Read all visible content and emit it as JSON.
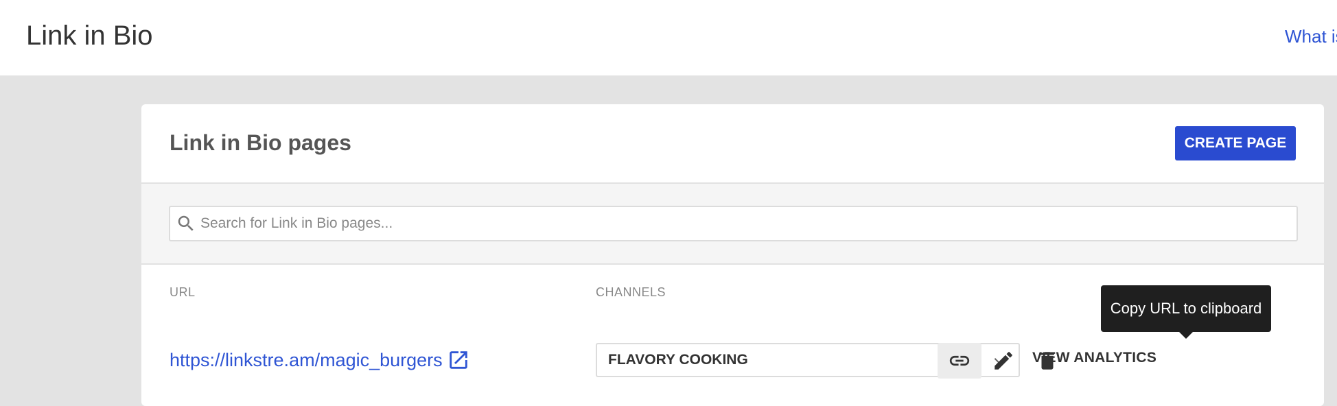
{
  "header": {
    "title": "Link in Bio",
    "help_link": "What is"
  },
  "card": {
    "title": "Link in Bio pages",
    "create_button": "CREATE PAGE"
  },
  "search": {
    "placeholder": "Search for Link in Bio pages...",
    "value": ""
  },
  "table": {
    "columns": [
      "URL",
      "CHANNELS"
    ],
    "rows": [
      {
        "url": "https://linkstre.am/magic_burgers",
        "channel": "FLAVORY COOKING",
        "analytics_label": "VIEW ANALYTICS"
      }
    ]
  },
  "tooltip": {
    "text": "Copy URL to clipboard"
  },
  "icons": {
    "search": "search-icon",
    "external": "external-link-icon",
    "dropdown": "chevron-down-icon",
    "copy": "link-icon",
    "edit": "pencil-icon",
    "delete": "trash-icon"
  },
  "colors": {
    "accent": "#2a4bd0",
    "link": "#2f55d4",
    "background": "#e3e3e3",
    "tooltip": "#1f1f1f"
  }
}
